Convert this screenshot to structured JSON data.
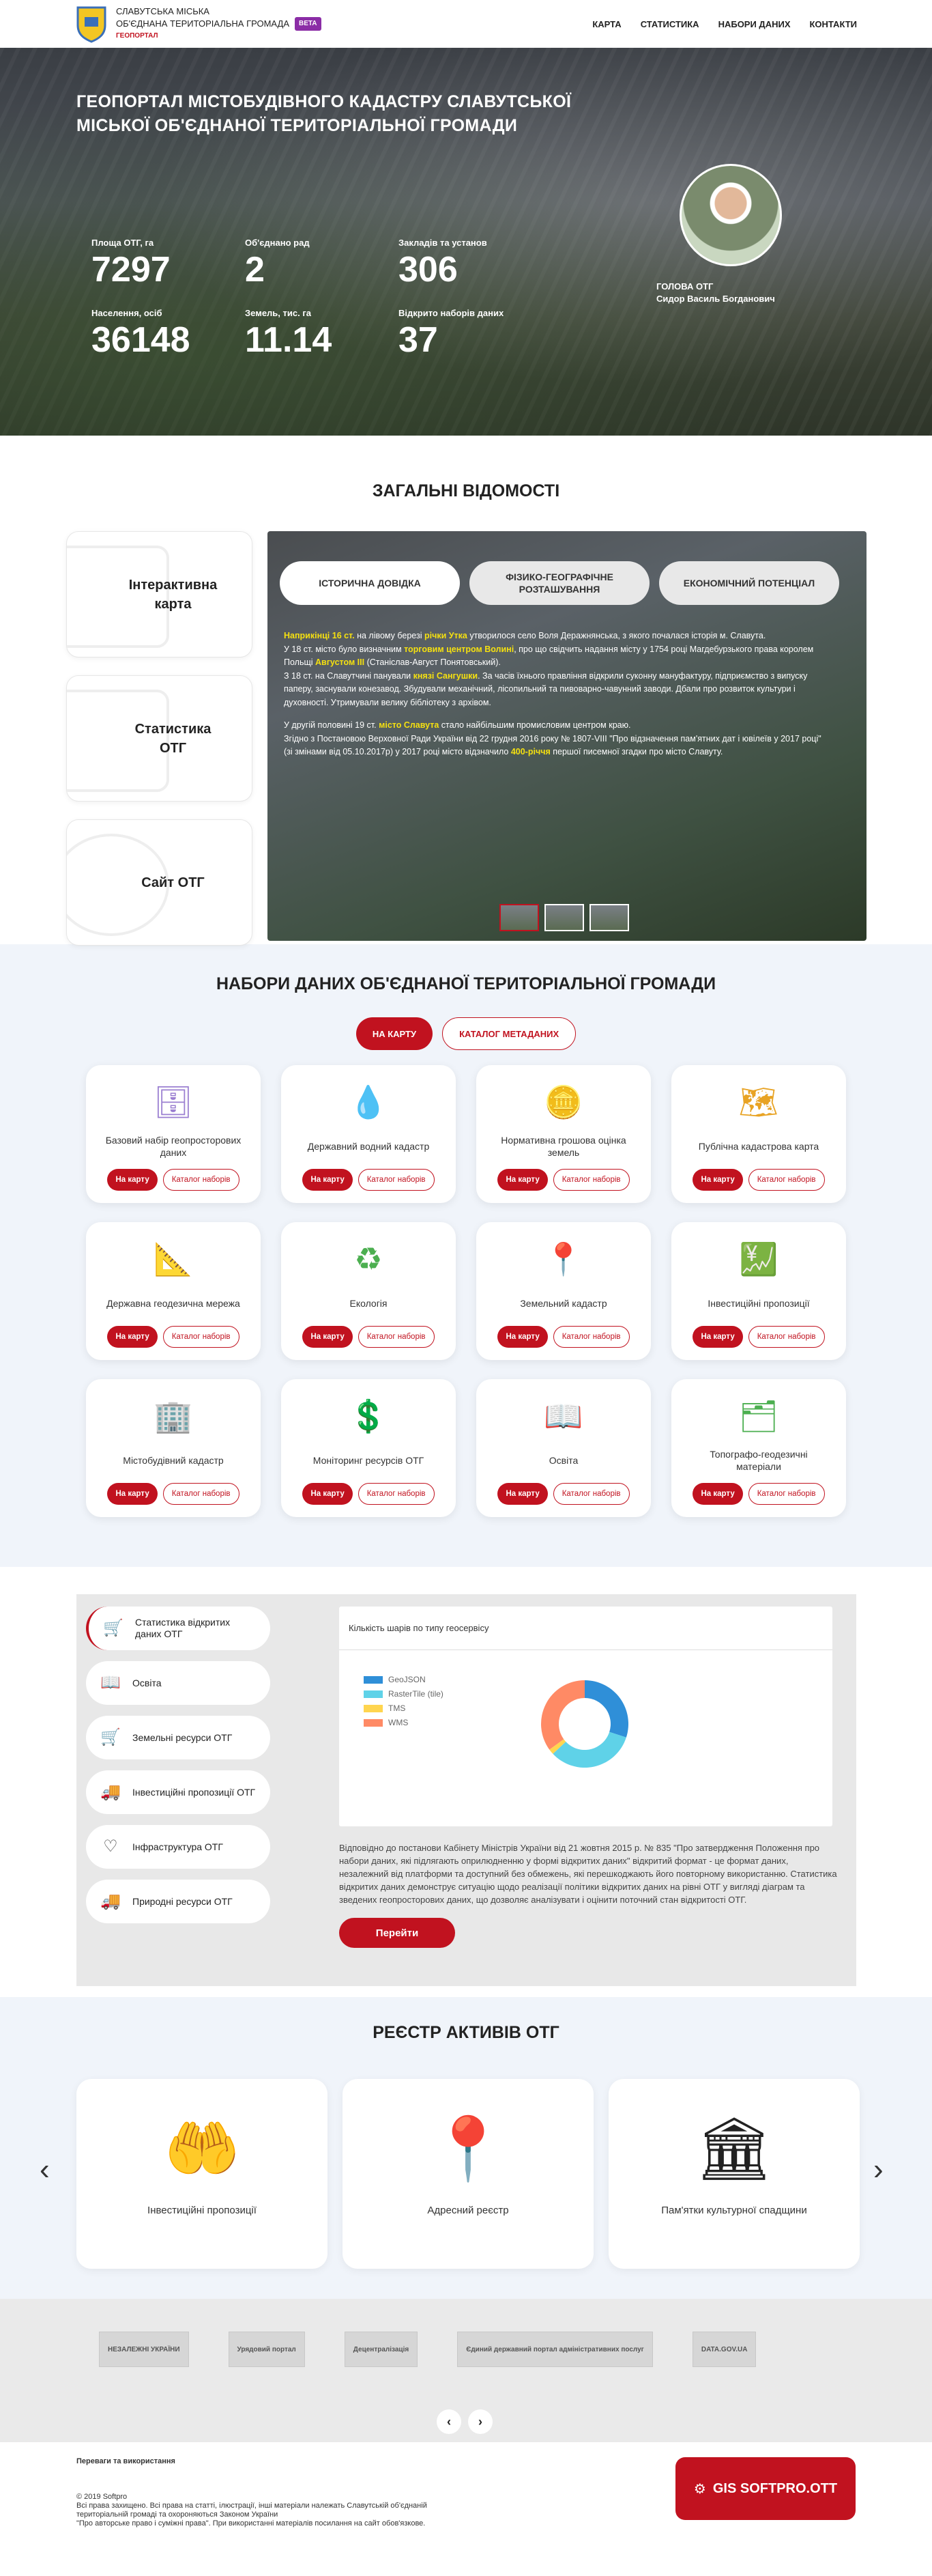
{
  "header": {
    "brand_line1": "СЛАВУТСЬКА МІСЬКА",
    "brand_line2": "ОБ'ЄДНАНА ТЕРИТОРІАЛЬНА ГРОМАДА",
    "beta": "BETA",
    "geoportal": "ГЕОПОРТАЛ",
    "nav": [
      "КАРТА",
      "СТАТИСТИКА",
      "НАБОРИ ДАНИХ",
      "КОНТАКТИ"
    ]
  },
  "hero": {
    "title": "ГЕОПОРТАЛ МІСТОБУДІВНОГО КАДАСТРУ СЛАВУТСЬКОЇ МІСЬКОЇ ОБ'ЄДНАНОЇ ТЕРИТОРІАЛЬНОЇ ГРОМАДИ",
    "stats": [
      {
        "label": "Площа ОТГ, га",
        "value": "7297"
      },
      {
        "label": "Об'єднано рад",
        "value": "2"
      },
      {
        "label": "Закладів та установ",
        "value": "306"
      },
      {
        "label": "Населення, осіб",
        "value": "36148"
      },
      {
        "label": "Земель, тис. га",
        "value": "11.14"
      },
      {
        "label": "Відкрито наборів даних",
        "value": "37"
      }
    ],
    "head_role": "ГОЛОВА ОТГ",
    "head_name": "Сидор Василь Богданович"
  },
  "general": {
    "title": "ЗАГАЛЬНІ ВІДОМОСТІ",
    "side_cards": [
      "Інтерактивна карта",
      "Статистика ОТГ",
      "Сайт ОТГ"
    ],
    "tabs": [
      "ІСТОРИЧНА ДОВІДКА",
      "ФІЗИКО-ГЕОГРАФІЧНЕ РОЗТАШУВАННЯ",
      "ЕКОНОМІЧНИЙ ПОТЕНЦІАЛ"
    ],
    "text": {
      "p1_hl1": "Наприкінці 16 ст.",
      "p1_a": " на лівому березі ",
      "p1_hl2": "річки Утка",
      "p1_b": " утворилося село Воля Деражнянська, з якого почалася історія м. Славута.",
      "p2_a": "У 18 ст. місто було визначним ",
      "p2_hl": "торговим центром Волині",
      "p2_b": ", про що свідчить надання місту у 1754 році Магдебурзького права королем Польщі ",
      "p2_hl2": "Августом III",
      "p2_c": " (Станіслав-Август Понятовський).",
      "p3_a": "З 18 ст. на Славутчині панували ",
      "p3_hl": "князі Сангушки",
      "p3_b": ". За часів їхнього правління відкрили суконну мануфактуру, підприємство з випуску паперу, заснували конезавод. Збудували механічний, лісопильний та пивоварно-чавунний заводи. Дбали про розвиток культури і духовності. Утримували велику бібліотеку з архівом.",
      "p4_a": "У другій половині 19 ст. ",
      "p4_hl": "місто Славута",
      "p4_b": " стало найбільшим промисловим центром краю.",
      "p5_a": "Згідно з Постановою Верховної Ради України від 22 грудня 2016 року № 1807-VIII \"Про відзначення пам'ятних дат і ювілеїв у 2017 році\" (зі змінами від 05.10.2017р) у 2017 році місто відзначило ",
      "p5_hl": "400-річчя",
      "p5_b": " першої писемної згадки про місто Славуту."
    }
  },
  "datasets": {
    "title": "НАБОРИ ДАНИХ ОБ'ЄДНАНОЇ ТЕРИТОРІАЛЬНОЇ ГРОМАДИ",
    "btn_map": "НА КАРТУ",
    "btn_catalog": "КАТАЛОГ МЕТАДАНИХ",
    "card_btn_map": "На карту",
    "card_btn_catalog": "Каталог наборів",
    "items": [
      {
        "title": "Базовий набір геопросторових даних",
        "icon": "database-gear-icon",
        "glyph": "🗄",
        "color": "#9b7fd1"
      },
      {
        "title": "Державний водний кадастр",
        "icon": "water-drop-icon",
        "glyph": "💧",
        "color": "#4fa3e0"
      },
      {
        "title": "Нормативна грошова оцінка земель",
        "icon": "coins-icon",
        "glyph": "🪙",
        "color": "#e8a324"
      },
      {
        "title": "Публічна кадастрова карта",
        "icon": "map-pin-icon",
        "glyph": "🗺",
        "color": "#e8a324"
      },
      {
        "title": "Державна геодезична мережа",
        "icon": "tripod-icon",
        "glyph": "📐",
        "color": "#e8a324"
      },
      {
        "title": "Екологія",
        "icon": "recycle-icon",
        "glyph": "♻",
        "color": "#4caf50"
      },
      {
        "title": "Земельний кадастр",
        "icon": "region-map-icon",
        "glyph": "📍",
        "color": "#4caf50"
      },
      {
        "title": "Інвестиційні пропозиції",
        "icon": "investment-icon",
        "glyph": "💹",
        "color": "#4caf50"
      },
      {
        "title": "Містобудівний кадастр",
        "icon": "buildings-icon",
        "glyph": "🏢",
        "color": "#7e8fd8"
      },
      {
        "title": "Моніторинг ресурсів ОТГ",
        "icon": "network-dollar-icon",
        "glyph": "💲",
        "color": "#3a6fb8"
      },
      {
        "title": "Освіта",
        "icon": "book-icon",
        "glyph": "📖",
        "color": "#3a6fb8"
      },
      {
        "title": "Топографо-геодезичні матеріали",
        "icon": "layers-icon",
        "glyph": "🗂",
        "color": "#4caf50"
      }
    ]
  },
  "open_data": {
    "menu": [
      {
        "label": "Статистика відкритих даних ОТГ",
        "icon": "cart-icon",
        "glyph": "🛒"
      },
      {
        "label": "Освіта",
        "icon": "open-book-icon",
        "glyph": "📖"
      },
      {
        "label": "Земельні ресурси ОТГ",
        "icon": "cart-icon",
        "glyph": "🛒"
      },
      {
        "label": "Інвестиційні пропозиції ОТГ",
        "icon": "truck-icon",
        "glyph": "🚚"
      },
      {
        "label": "Інфраструктура ОТГ",
        "icon": "heart-pulse-icon",
        "glyph": "♡"
      },
      {
        "label": "Природні ресурси ОТГ",
        "icon": "truck-icon",
        "glyph": "🚚"
      }
    ],
    "chart_title": "Кількість шарів по типу геосервісу",
    "text": "Відповідно до постанови Кабінету Міністрів України від 21 жовтня 2015 р. № 835 \"Про затвердження Положення про набори даних, які підлягають оприлюдненню у формі відкритих даних\" відкритий формат - це формат даних, незалежний від платформи та доступний без обмежень, які перешкоджають його повторному використанню. Статистика відкритих даних демонструє ситуацію щодо реалізації політики відкритих даних на рівні ОТГ у вигляді діаграм та зведених геопросторових даних, що дозволяє аналізувати і оцінити поточний стан відкритості ОТГ.",
    "go": "Перейти"
  },
  "chart_data": {
    "type": "pie",
    "title": "Кількість шарів по типу геосервісу",
    "categories": [
      "GeoJSON",
      "RasterTile (tile)",
      "TMS",
      "WMS"
    ],
    "values": [
      30,
      33,
      2,
      35
    ],
    "colors": [
      "#2f8fd8",
      "#5fd2e8",
      "#ffd54f",
      "#ff8a65"
    ]
  },
  "registry": {
    "title": "РЕЄСТР АКТИВІВ ОТГ",
    "cards": [
      {
        "label": "Інвестиційні пропозиції",
        "icon": "hands-dollar-icon",
        "glyph": "🤲"
      },
      {
        "label": "Адресний реєстр",
        "icon": "location-pin-icon",
        "glyph": "📍"
      },
      {
        "label": "Пам'ятки культурної спадщини",
        "icon": "museum-icon",
        "glyph": "🏛"
      }
    ]
  },
  "partners": [
    "НЕЗАЛЕЖНІ УКРАЇНИ",
    "Урядовий портал",
    "Децентралізація",
    "Єдиний державний портал адміністративних послуг",
    "DATA.GOV.UA"
  ],
  "footer": {
    "terms": "Переваги та використання",
    "copy1": "© 2019 Softpro",
    "copy2": "Всі права захищено. Всі права на статті, ілюстрації, інші матеріали належать Славутській об'єднаній територіальній громаді та охороняються Законом України",
    "copy3": "\"Про авторське право і суміжні права\". При використанні матеріалів посилання на сайт обов'язкове.",
    "softpro": "GIS SOFTPRO.OTT"
  }
}
